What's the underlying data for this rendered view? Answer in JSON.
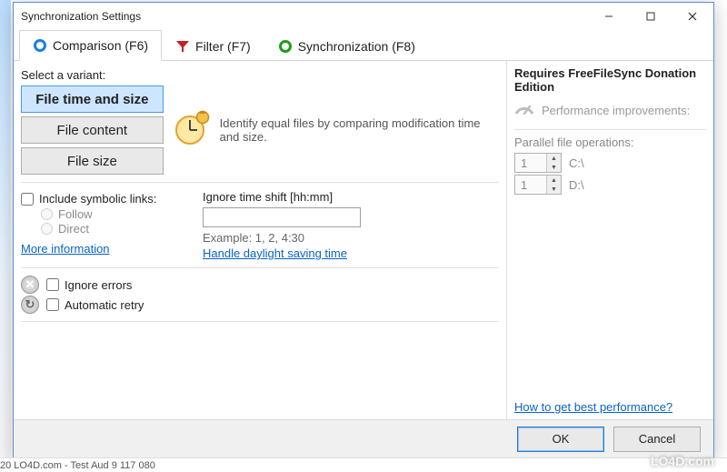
{
  "window": {
    "title": "Synchronization Settings"
  },
  "tabs": [
    {
      "label": "Comparison (F6)"
    },
    {
      "label": "Filter (F7)"
    },
    {
      "label": "Synchronization (F8)"
    }
  ],
  "left": {
    "select_variant": "Select a variant:",
    "variants": {
      "time_size": "File time and size",
      "content": "File content",
      "size": "File size"
    },
    "explain": "Identify equal files by comparing modification time and size.",
    "symbolic": {
      "label": "Include symbolic links:",
      "follow": "Follow",
      "direct": "Direct",
      "more_info": "More information"
    },
    "timeshift": {
      "label": "Ignore time shift [hh:mm]",
      "value": "",
      "example": "Example: 1, 2, 4:30",
      "dst_link": "Handle daylight saving time"
    },
    "ignore_errors": "Ignore errors",
    "auto_retry": "Automatic retry"
  },
  "right": {
    "donation": "Requires FreeFileSync Donation Edition",
    "perf_title": "Performance improvements:",
    "parallel_label": "Parallel file operations:",
    "rows": [
      {
        "value": "1",
        "drive": "C:\\"
      },
      {
        "value": "1",
        "drive": "D:\\"
      }
    ],
    "best_perf": "How to get best performance?"
  },
  "buttons": {
    "ok": "OK",
    "cancel": "Cancel"
  },
  "watermark": "LO4D.com",
  "bottom_strip": "20   LO4D.com - Test Aud            9 117 080"
}
